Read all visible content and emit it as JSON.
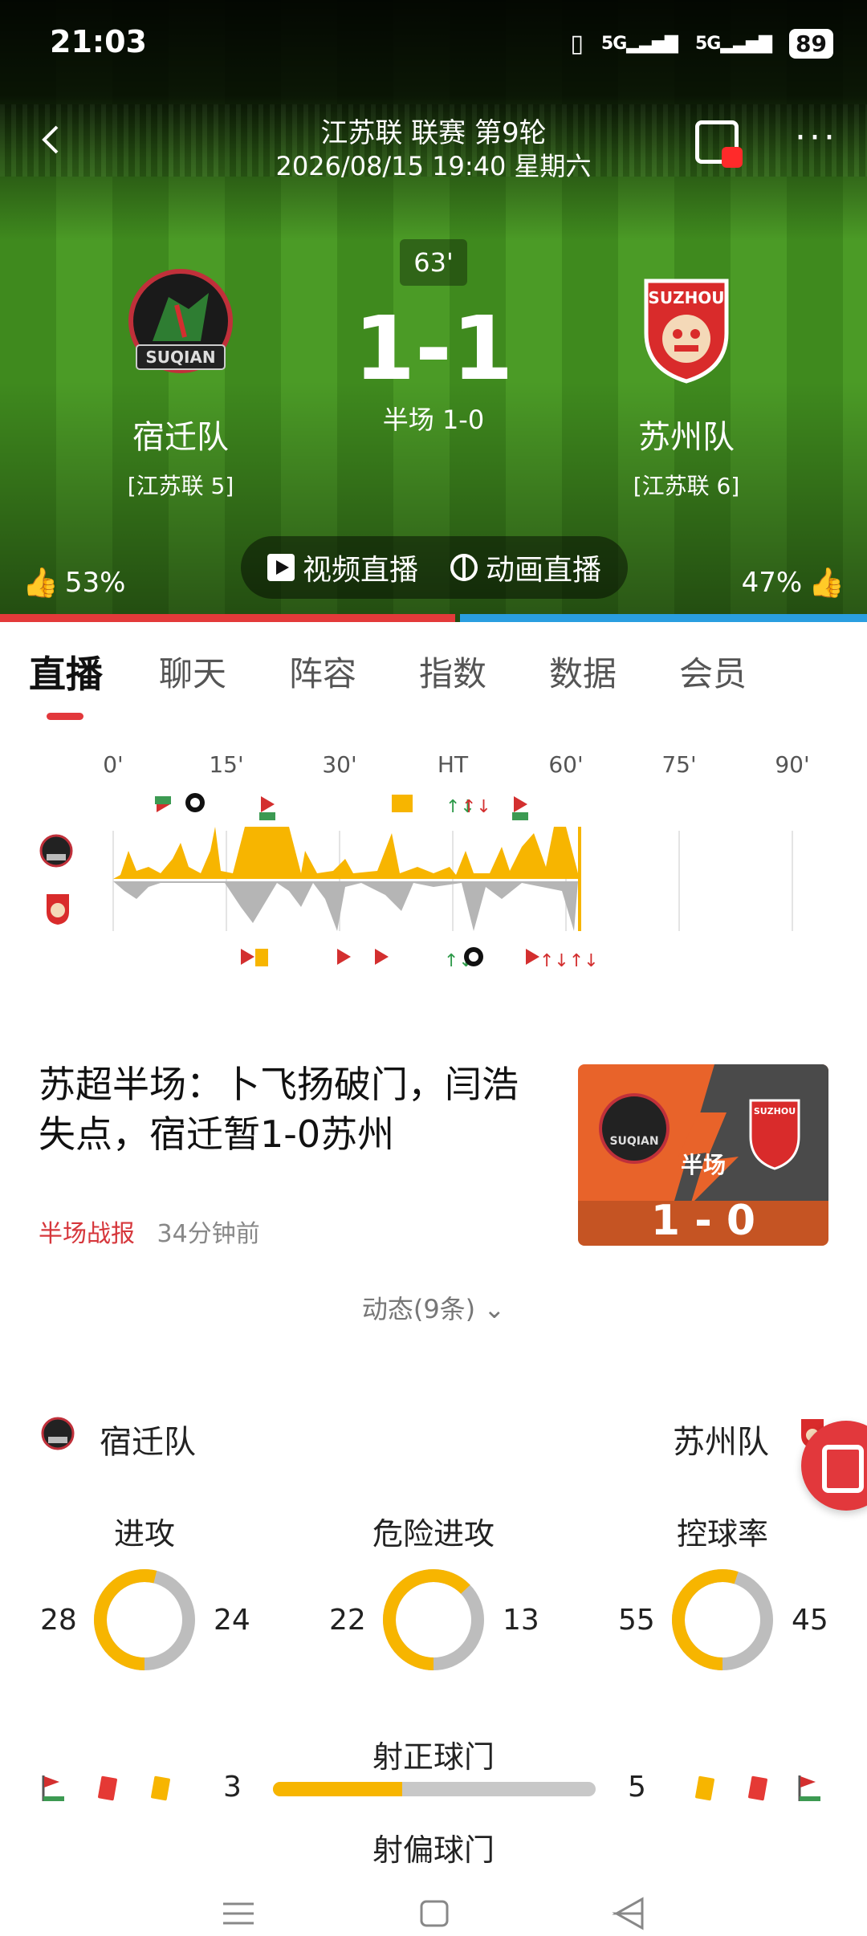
{
  "status_bar": {
    "time": "21:03",
    "signal1": "5G",
    "signal2": "5G",
    "battery": "89"
  },
  "match": {
    "league": "江苏联 联赛 第9轮",
    "datetime": "2026/08/15 19:40 星期六",
    "minute": "63'",
    "score": "1-1",
    "halftime": "半场 1-0",
    "home": {
      "name": "宿迁队",
      "rank": "[江苏联 5]",
      "logo_text": "SUQIAN",
      "vote": "53%"
    },
    "away": {
      "name": "苏州队",
      "rank": "[江苏联 6]",
      "logo_text": "SUZHOU",
      "vote": "47%"
    },
    "vote_home_fraction": 0.53
  },
  "live_buttons": {
    "video": "视频直播",
    "animation": "动画直播"
  },
  "tabs": [
    {
      "label": "直播"
    },
    {
      "label": "聊天"
    },
    {
      "label": "阵容"
    },
    {
      "label": "指数"
    },
    {
      "label": "数据"
    },
    {
      "label": "会员"
    }
  ],
  "timeline": {
    "ticks": [
      "0'",
      "15'",
      "30'",
      "HT",
      "60'",
      "75'",
      "90'"
    ],
    "current_minute": 63
  },
  "news": {
    "title": "苏超半场：卜飞扬破门，闫浩失点，宿迁暂1-0苏州",
    "tag": "半场战报",
    "time": "34分钟前",
    "image_label": "半场",
    "image_score": "1  -  0",
    "image_home_text": "SUQIAN",
    "image_away_text": "SUZHOU"
  },
  "dynamics": "动态(9条)",
  "stats": {
    "home_name": "宿迁队",
    "away_name": "苏州队",
    "donuts": [
      {
        "title": "进攻",
        "home": 28,
        "away": 24
      },
      {
        "title": "危险进攻",
        "home": 22,
        "away": 13
      },
      {
        "title": "控球率",
        "home": 55,
        "away": 45
      }
    ],
    "shots_on_title": "射正球门",
    "shots_off_title": "射偏球门",
    "shots_home": "3",
    "shots_away": "5",
    "shots_home_fraction": 0.4
  },
  "colors": {
    "home": "#f7b500",
    "away": "#bdbdbd",
    "accent": "#e2383c",
    "blue": "#2a9ee0"
  }
}
